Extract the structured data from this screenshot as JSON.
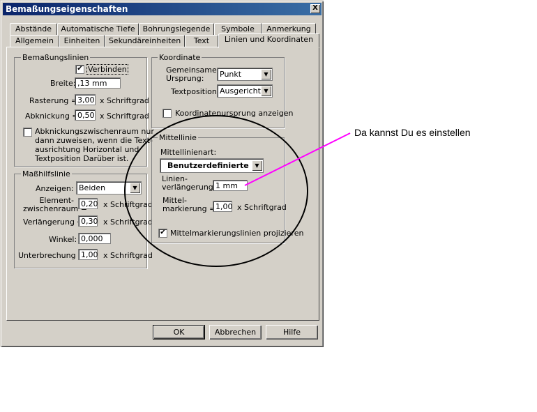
{
  "window": {
    "title": "Bemaßungseigenschaften",
    "close_label": "X"
  },
  "tabs_row1": [
    "Abstände",
    "Automatische Tiefe",
    "Bohrungslegende",
    "Symbole",
    "Anmerkung"
  ],
  "tabs_row2": [
    "Allgemein",
    "Einheiten",
    "Sekundäreinheiten",
    "Text",
    "Linien und Koordinaten"
  ],
  "bemassungslinien": {
    "title": "Bemaßungslinien",
    "verbinden_label": "Verbinden",
    "verbinden_checked": true,
    "breite_label": "Breite:",
    "breite_value": ",13 mm",
    "rasterung_label": "Rasterung =",
    "rasterung_value": "3,00",
    "rasterung_unit": "x Schriftgrad",
    "abknickung_label": "Abknickung =",
    "abknickung_value": "0,50",
    "abknickung_unit": "x Schriftgrad",
    "abstand_text": [
      "Abknickungszwischenraum nur",
      "dann zuweisen, wenn die Text-",
      "ausrichtung Horizontal und",
      "Textposition Darüber ist."
    ],
    "abstand_checked": false
  },
  "masshilfslinie": {
    "title": "Maßhilfslinie",
    "anzeigen_label": "Anzeigen:",
    "anzeigen_value": "Beiden",
    "element_label": [
      "Element-",
      "zwischenraum ="
    ],
    "element_value": "0,20",
    "element_unit": "x Schriftgrad",
    "verlaengerung_label": "Verlängerung =",
    "verlaengerung_value": "0,30",
    "verlaengerung_unit": "x Schriftgrad",
    "winkel_label": "Winkel:",
    "winkel_value": "0,000",
    "unterbrechung_label": "Unterbrechung =",
    "unterbrechung_value": "1,00",
    "unterbrechung_unit": "x Schriftgrad"
  },
  "koordinate": {
    "title": "Koordinate",
    "ursprung_label": [
      "Gemeinsamer",
      "Ursprung:"
    ],
    "ursprung_value": "Punkt",
    "textposition_label": "Textposition:",
    "textposition_value": "Ausgerichtet",
    "anzeigen_label": "Koordinatenursprung anzeigen",
    "anzeigen_checked": false
  },
  "mittellinie": {
    "title": "Mittellinie",
    "art_label": "Mittellinienart:",
    "art_value": "Benutzerdefinierte Lin",
    "verl_label": [
      "Linien-",
      "verlängerung:"
    ],
    "verl_value": "1 mm",
    "mark_label": [
      "Mittel-",
      "markierung ="
    ],
    "mark_value": "1,00",
    "mark_unit": "x Schriftgrad",
    "projizieren_label": "Mittelmarkierungslinien projizieren",
    "projizieren_checked": true
  },
  "buttons": {
    "ok": "OK",
    "abbrechen": "Abbrechen",
    "hilfe": "Hilfe"
  },
  "annotation": {
    "text": "Da kannst Du es einstellen",
    "color": "#ff00ff"
  }
}
